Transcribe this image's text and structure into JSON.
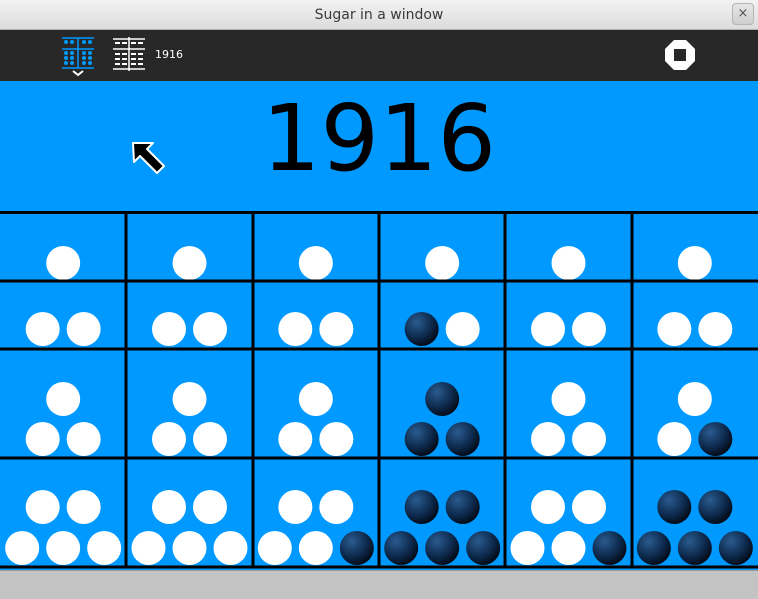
{
  "window": {
    "title": "Sugar in a window",
    "close_glyph": "×"
  },
  "toolbar": {
    "activity_icon": "abacus-activity-icon",
    "abacus_icon": "abacus-icon",
    "value_label": "1916",
    "stop_icon": "stop-icon"
  },
  "display": {
    "value": "1916"
  },
  "colors": {
    "background": "#0099ff",
    "toolbar": "#282828",
    "bead_on": "#0a1e3c",
    "bead_off": "#ffffff",
    "grid": "#000000"
  },
  "abacus": {
    "columns": 6,
    "row_capacities": [
      1,
      2,
      3,
      5
    ],
    "active_beads": [
      [
        0,
        0,
        0,
        0,
        0,
        0
      ],
      [
        0,
        0,
        0,
        1,
        0,
        0
      ],
      [
        0,
        0,
        0,
        3,
        0,
        1
      ],
      [
        0,
        0,
        1,
        5,
        1,
        5
      ]
    ]
  }
}
